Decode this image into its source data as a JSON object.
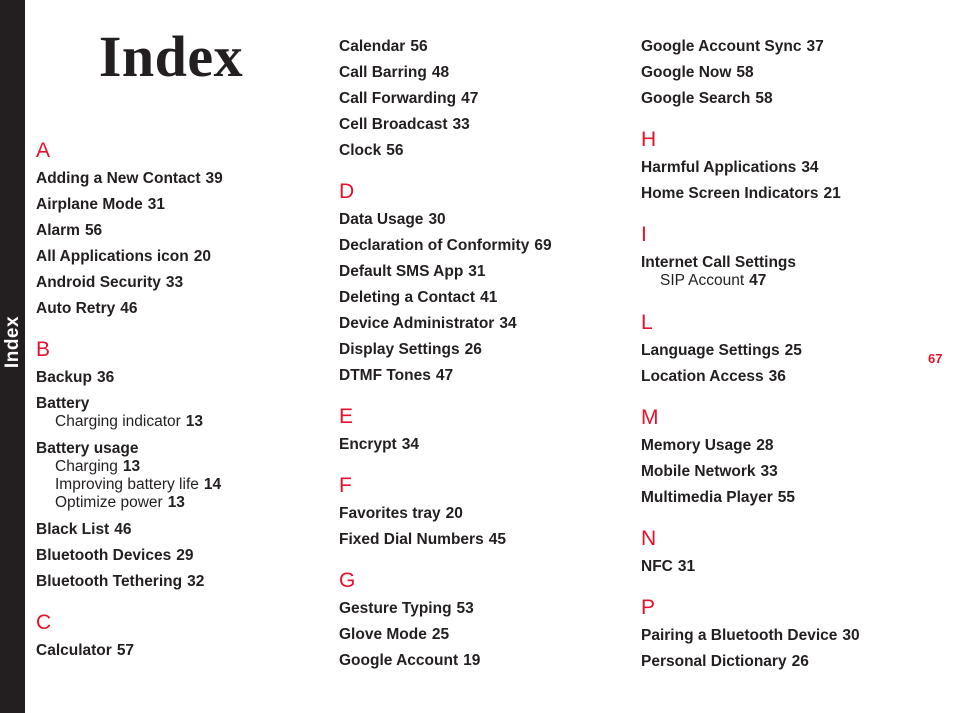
{
  "side_tab": {
    "label": "Index"
  },
  "page_title": "Index",
  "page_number": "67",
  "colors": {
    "accent_red": "#e8112d",
    "text": "#231f20",
    "tab_background": "#231f20",
    "background": "#ffffff"
  },
  "columns": [
    {
      "id": "column-1",
      "sections": [
        {
          "letter": "A",
          "entries": [
            {
              "label": "Adding a New Contact",
              "page": "39"
            },
            {
              "label": "Airplane Mode",
              "page": "31"
            },
            {
              "label": "Alarm",
              "page": "56"
            },
            {
              "label": "All Applications icon",
              "page": "20"
            },
            {
              "label": "Android Security",
              "page": "33"
            },
            {
              "label": "Auto Retry",
              "page": "46"
            }
          ]
        },
        {
          "letter": "B",
          "entries": [
            {
              "label": "Backup",
              "page": "36"
            },
            {
              "label": "Battery",
              "page": "",
              "subentries": [
                {
                  "label": "Charging indicator",
                  "page": "13"
                }
              ]
            },
            {
              "label": "Battery usage",
              "page": "",
              "subentries": [
                {
                  "label": "Charging",
                  "page": "13"
                },
                {
                  "label": "Improving battery life",
                  "page": "14"
                },
                {
                  "label": "Optimize power",
                  "page": "13"
                }
              ]
            },
            {
              "label": "Black List",
              "page": "46"
            },
            {
              "label": "Bluetooth Devices",
              "page": "29"
            },
            {
              "label": "Bluetooth Tethering",
              "page": "32"
            }
          ]
        },
        {
          "letter": "C",
          "entries": [
            {
              "label": "Calculator",
              "page": "57"
            }
          ]
        }
      ]
    },
    {
      "id": "column-2",
      "sections": [
        {
          "letter": "",
          "entries": [
            {
              "label": "Calendar",
              "page": "56"
            },
            {
              "label": "Call Barring",
              "page": "48"
            },
            {
              "label": "Call Forwarding",
              "page": "47"
            },
            {
              "label": "Cell Broadcast",
              "page": "33"
            },
            {
              "label": "Clock",
              "page": "56"
            }
          ]
        },
        {
          "letter": "D",
          "entries": [
            {
              "label": "Data Usage",
              "page": "30"
            },
            {
              "label": "Declaration of Conformity",
              "page": "69"
            },
            {
              "label": "Default SMS App",
              "page": "31"
            },
            {
              "label": "Deleting a Contact",
              "page": "41"
            },
            {
              "label": "Device Administrator",
              "page": "34"
            },
            {
              "label": "Display Settings",
              "page": "26"
            },
            {
              "label": "DTMF Tones",
              "page": "47"
            }
          ]
        },
        {
          "letter": "E",
          "entries": [
            {
              "label": "Encrypt",
              "page": "34"
            }
          ]
        },
        {
          "letter": "F",
          "entries": [
            {
              "label": "Favorites tray",
              "page": "20"
            },
            {
              "label": "Fixed Dial Numbers",
              "page": "45"
            }
          ]
        },
        {
          "letter": "G",
          "entries": [
            {
              "label": "Gesture Typing",
              "page": "53"
            },
            {
              "label": "Glove Mode",
              "page": "25"
            },
            {
              "label": "Google Account",
              "page": "19"
            }
          ]
        }
      ]
    },
    {
      "id": "column-3",
      "sections": [
        {
          "letter": "",
          "entries": [
            {
              "label": "Google Account Sync",
              "page": "37"
            },
            {
              "label": "Google Now",
              "page": "58"
            },
            {
              "label": "Google Search",
              "page": "58"
            }
          ]
        },
        {
          "letter": "H",
          "entries": [
            {
              "label": "Harmful Applications",
              "page": "34"
            },
            {
              "label": "Home Screen Indicators",
              "page": "21"
            }
          ]
        },
        {
          "letter": "I",
          "entries": [
            {
              "label": "Internet Call Settings",
              "page": "",
              "subentries": [
                {
                  "label": "SIP Account",
                  "page": "47"
                }
              ]
            }
          ]
        },
        {
          "letter": "L",
          "entries": [
            {
              "label": "Language Settings",
              "page": "25"
            },
            {
              "label": "Location Access",
              "page": "36"
            }
          ]
        },
        {
          "letter": "M",
          "entries": [
            {
              "label": "Memory Usage",
              "page": "28"
            },
            {
              "label": "Mobile Network",
              "page": "33"
            },
            {
              "label": "Multimedia Player",
              "page": "55"
            }
          ]
        },
        {
          "letter": "N",
          "entries": [
            {
              "label": "NFC",
              "page": "31"
            }
          ]
        },
        {
          "letter": "P",
          "entries": [
            {
              "label": "Pairing a Bluetooth Device",
              "page": "30"
            },
            {
              "label": "Personal Dictionary",
              "page": "26"
            }
          ]
        }
      ]
    }
  ]
}
